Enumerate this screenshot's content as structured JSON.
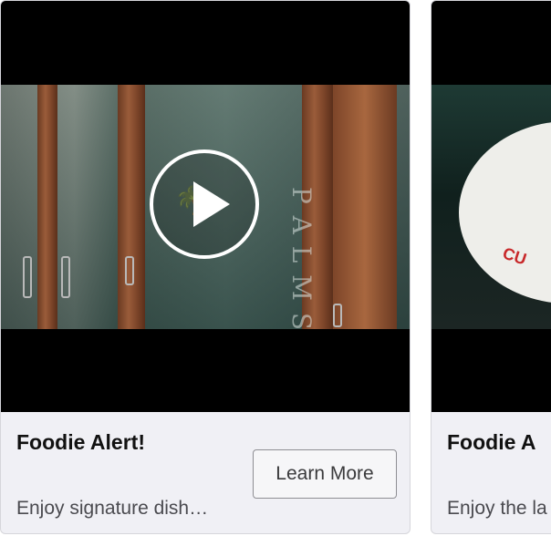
{
  "cards": [
    {
      "title": "Foodie Alert!",
      "description": "Enjoy signature dish…",
      "cta_label": "Learn More",
      "media_icon": "play-icon"
    },
    {
      "title": "Foodie A",
      "description": "Enjoy the la",
      "logo_fragment": "CU"
    }
  ],
  "colors": {
    "card_background": "#f0f0f5",
    "video_letterbox": "#000000",
    "button_border": "#8e8e93",
    "title_text": "#111111",
    "description_text": "#4a4a4f"
  }
}
